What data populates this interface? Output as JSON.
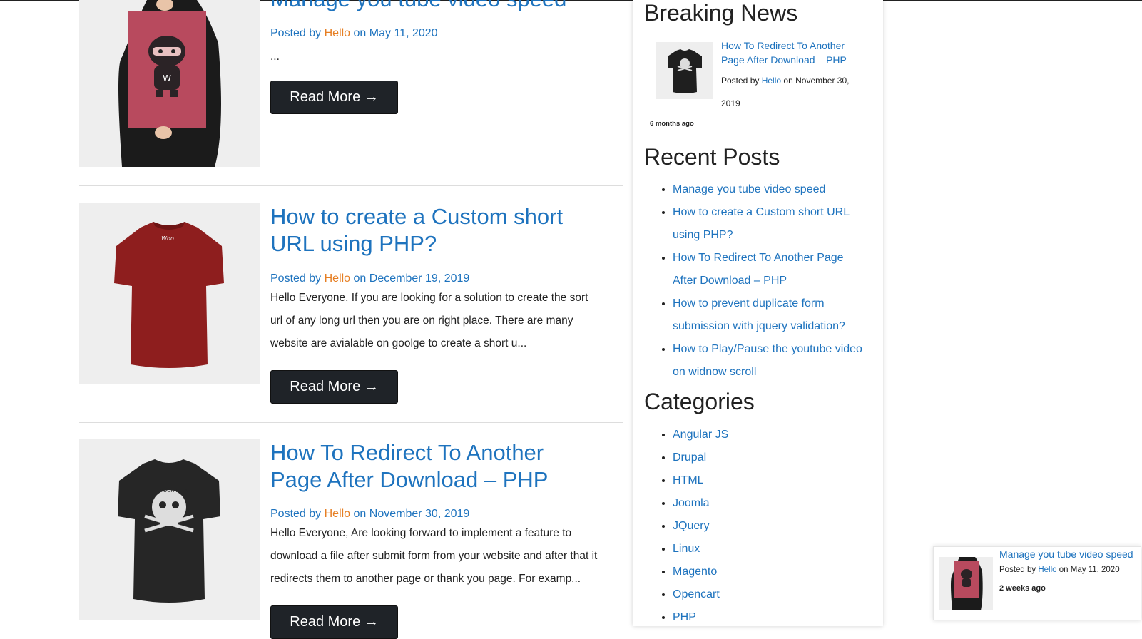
{
  "posts": [
    {
      "title": "Manage you tube video speed",
      "posted_by": "Posted by",
      "author": "Hello",
      "on": "on",
      "date": "May 11, 2020",
      "excerpt": "...",
      "read_more": "Read More →"
    },
    {
      "title_line1": "How to create a Custom short",
      "title_line2": "URL using PHP?",
      "posted_by": "Posted by",
      "author": "Hello",
      "on": "on",
      "date": "December 19, 2019",
      "excerpt_lines": [
        "Hello Everyone, If you are looking for a solution to create the sort",
        "url of any long url then you are on right place. There are many",
        "website are avialable on goolge to create a short u..."
      ],
      "read_more": "Read More →"
    },
    {
      "title_line1": "How To Redirect To Another",
      "title_line2": "Page After Download – PHP",
      "posted_by": "Posted by",
      "author": "Hello",
      "on": "on",
      "date": "November 30, 2019",
      "excerpt_lines": [
        "Hello Everyone, Are looking forward to implement a feature to",
        "download a file after submit form from your website and after that it",
        "redirects them to another page or thank you page. For examp..."
      ],
      "read_more": "Read More →"
    }
  ],
  "sidebar": {
    "breaking_news": {
      "heading": "Breaking News",
      "item_title_line1": "How To Redirect To Another",
      "item_title_line2": "Page After Download – PHP",
      "posted_by": "Posted by",
      "author": "Hello",
      "on_date_line1": "on November 30,",
      "on_date_line2": "2019",
      "ago": "6 months ago"
    },
    "recent_posts": {
      "heading": "Recent Posts",
      "items": [
        [
          "Manage you tube video speed"
        ],
        [
          "How to create a Custom short URL",
          "using PHP?"
        ],
        [
          "How To Redirect To Another Page",
          "After Download – PHP"
        ],
        [
          "How to prevent duplicate form",
          "submission with jquery validation?"
        ],
        [
          "How to Play/Pause the youtube video",
          "on widnow scroll"
        ]
      ]
    },
    "categories": {
      "heading": "Categories",
      "items": [
        "Angular JS",
        "Drupal",
        "HTML",
        "Joomla",
        "JQuery",
        "Linux",
        "Magento",
        "Opencart",
        "PHP"
      ]
    }
  },
  "popup": {
    "title": "Manage you tube video speed",
    "posted_by": "Posted by",
    "author": "Hello",
    "on_date": "on May 11, 2020",
    "ago": "2 weeks ago"
  },
  "icons": {
    "ninja_poster": "ninja-poster-image",
    "red_tshirt": "red-tshirt-image",
    "black_tshirt": "black-tshirt-image"
  }
}
